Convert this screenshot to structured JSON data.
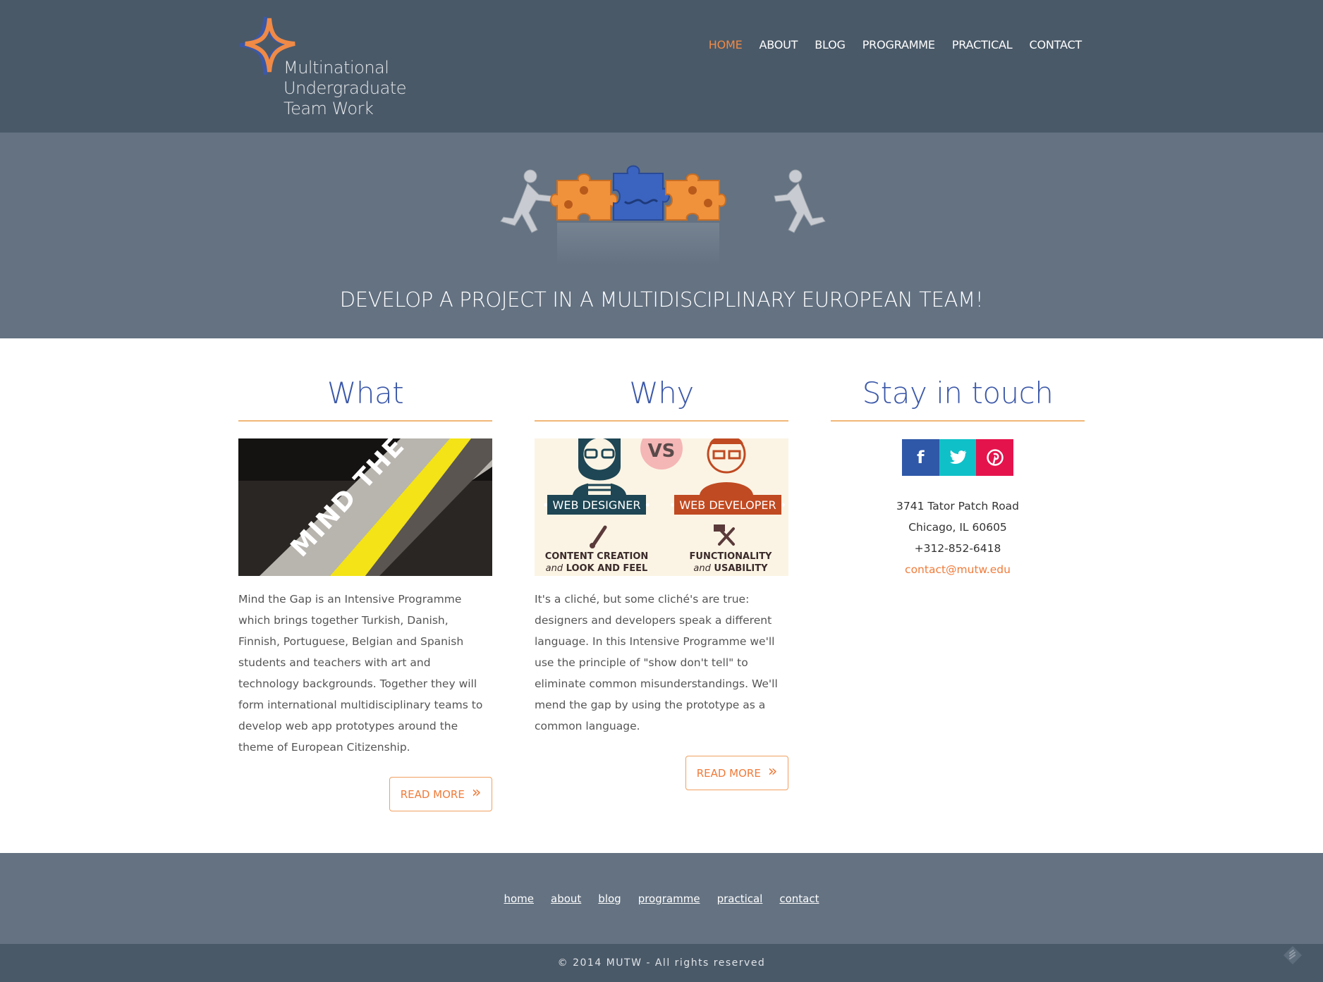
{
  "brand": {
    "logo_lines": [
      "Multinational",
      "Undergraduate",
      "Team Work"
    ],
    "accent": "#f08a46",
    "header_bg": "#4a5968",
    "hero_bg": "#647282",
    "heading_blue": "#3b58a8"
  },
  "nav": {
    "items": [
      {
        "label": "HOME",
        "active": true
      },
      {
        "label": "ABOUT"
      },
      {
        "label": "BLOG"
      },
      {
        "label": "PROGRAMME"
      },
      {
        "label": "PRACTICAL"
      },
      {
        "label": "CONTACT"
      }
    ]
  },
  "hero": {
    "title": "DEVELOP A PROJECT IN A MULTIDISCIPLINARY EUROPEAN TEAM!"
  },
  "what": {
    "heading": "What",
    "image_text": "MIND THE GAP",
    "body": "Mind the Gap is an Intensive Programme which brings together Turkish, Danish, Finnish, Portuguese, Belgian and Spanish students and teachers with art and technology backgrounds. Together they will form international multidisciplinary teams to develop web app prototypes around the theme of European Citizenship.",
    "button": "READ MORE",
    "button_icon": "double-chevron-right-icon"
  },
  "why": {
    "heading": "Why",
    "image": {
      "vs": "VS",
      "left_role": "• WEB DESIGNER •",
      "right_role": "• WEB DEVELOPER •",
      "left_caption_1": "CONTENT CREATION",
      "left_caption_2_italic": "and",
      "left_caption_2": "LOOK AND FEEL",
      "right_caption_1": "FUNCTIONALITY",
      "right_caption_2_italic": "and",
      "right_caption_2": "USABILITY"
    },
    "body": "It's a cliché, but some cliché's are true: designers and developers speak a different language. In this Intensive Programme we'll use the principle of \"show don't tell\" to eliminate common misunderstandings. We'll mend the gap by using the prototype as a common language.",
    "button": "READ MORE"
  },
  "stay": {
    "heading": "Stay in touch",
    "social": [
      {
        "icon": "facebook-icon",
        "glyph": "f",
        "color": "#2f58a8"
      },
      {
        "icon": "twitter-icon",
        "glyph": "🐦",
        "color": "#10c0c8"
      },
      {
        "icon": "pinterest-icon",
        "glyph": "P",
        "color": "#e5134c"
      }
    ],
    "address_1": "3741 Tator Patch Road",
    "address_2": "Chicago, IL 60605",
    "phone": "+312-852-6418",
    "email": "contact@mutw.edu"
  },
  "footer": {
    "links": [
      "home",
      "about",
      "blog",
      "programme",
      "practical",
      "contact"
    ],
    "copyright": "© 2014 MUTW - All rights reserved"
  }
}
